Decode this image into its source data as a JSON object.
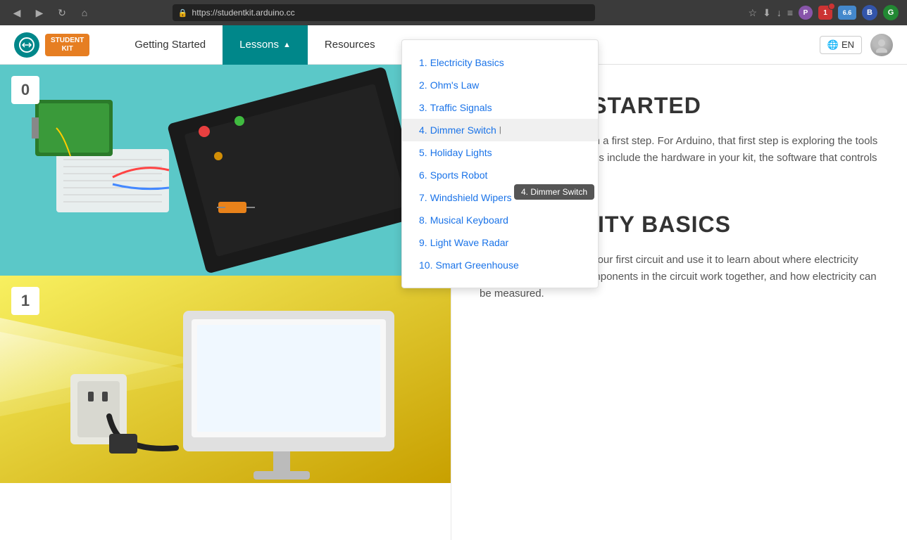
{
  "browser": {
    "url": "https://studentkit.arduino.cc",
    "back_icon": "◀",
    "forward_icon": "▶",
    "refresh_icon": "↻",
    "home_icon": "⌂"
  },
  "navbar": {
    "logo_text": "∞",
    "student_kit_line1": "STUDENT",
    "student_kit_line2": "KIT",
    "nav_items": [
      {
        "id": "getting-started",
        "label": "Getting Started",
        "active": false
      },
      {
        "id": "lessons",
        "label": "Lessons",
        "active": true,
        "has_dropdown": true
      },
      {
        "id": "resources",
        "label": "Resources",
        "active": false
      }
    ],
    "lang": "EN",
    "globe_icon": "🌐"
  },
  "dropdown": {
    "items": [
      {
        "num": "1",
        "label": "Electricity Basics"
      },
      {
        "num": "2",
        "label": "Ohm's Law"
      },
      {
        "num": "3",
        "label": "Traffic Signals"
      },
      {
        "num": "4",
        "label": "Dimmer Switch"
      },
      {
        "num": "5",
        "label": "Holiday Lights"
      },
      {
        "num": "6",
        "label": "Sports Robot"
      },
      {
        "num": "7",
        "label": "Windshield Wipers"
      },
      {
        "num": "8",
        "label": "Musical Keyboard"
      },
      {
        "num": "9",
        "label": "Light Wave Radar"
      },
      {
        "num": "10",
        "label": "Smart Greenhouse"
      }
    ],
    "tooltip": "4. Dimmer Switch"
  },
  "cards": [
    {
      "number": "0",
      "bg_color_start": "#5bc8c8",
      "bg_color_end": "#3a9898"
    },
    {
      "number": "1",
      "bg_color_start": "#f8e840",
      "bg_color_end": "#c8b810"
    }
  ],
  "sections": [
    {
      "id": "getting-started",
      "title": "GETTING STARTED",
      "text": "Every journey begins with a first step. For Arduino, that first step is exploring the tools that you'll use. These tools include the hardware in your kit, the software that controls the hardware, and good"
    },
    {
      "id": "electricity-basics",
      "title": "ELECTRICITY BASICS",
      "text": "In this lesson, you build your first circuit and use it to learn about where electricity comes from, how the components in the circuit work together, and how electricity can be measured."
    }
  ]
}
